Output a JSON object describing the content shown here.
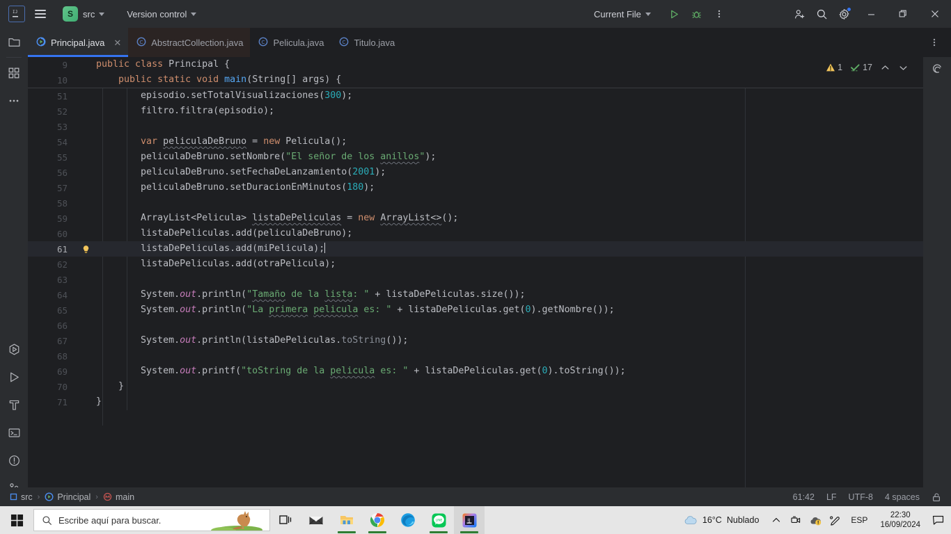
{
  "titlebar": {
    "ij_logo": "intellij-idea-logo",
    "menu_icon": "hamburger-menu-icon",
    "project_badge": "S",
    "project_name": "src",
    "version_control": "Version control",
    "run_config": "Current File",
    "run_icon": "run-icon",
    "debug_icon": "debug-icon",
    "more_icon": "more-vertical-icon",
    "share_icon": "add-user-icon",
    "search_icon": "search-icon",
    "settings_icon": "gear-icon",
    "minimize": "—",
    "maximize": "▢",
    "close": "✕"
  },
  "tabs": [
    {
      "label": "Principal.java",
      "icon": "java-class-run-icon",
      "active": true,
      "closable": true
    },
    {
      "label": "AbstractCollection.java",
      "icon": "java-class-icon",
      "active": false,
      "dim": true
    },
    {
      "label": "Pelicula.java",
      "icon": "java-class-icon",
      "active": false
    },
    {
      "label": "Titulo.java",
      "icon": "java-class-icon",
      "active": false
    }
  ],
  "tabbar_more_icon": "more-vertical-icon",
  "left_rail": {
    "top": [
      {
        "name": "project-icon",
        "title": "Project"
      },
      {
        "name": "commit-icon",
        "title": "Commit"
      },
      {
        "name": "more-tool-windows-icon",
        "title": "More tool windows"
      }
    ],
    "bottom": [
      {
        "name": "run-anything-icon",
        "title": "Run Anything"
      },
      {
        "name": "run-icon",
        "title": "Run"
      },
      {
        "name": "build-icon",
        "title": "Build"
      },
      {
        "name": "terminal-icon",
        "title": "Terminal"
      },
      {
        "name": "problems-icon",
        "title": "Problems"
      },
      {
        "name": "git-icon",
        "title": "Git"
      }
    ]
  },
  "right_rail": {
    "items": [
      {
        "name": "notifications-bell-icon",
        "badge": true
      },
      {
        "name": "ai-assistant-icon",
        "badge": false
      }
    ]
  },
  "inspections": {
    "warning_icon": "warning-triangle-icon",
    "warning_count": "1",
    "ok_icon": "inspections-ok-icon",
    "ok_count": "17",
    "prev_icon": "chevron-up-icon",
    "next_icon": "chevron-down-icon"
  },
  "editor": {
    "sticky_lines": [
      {
        "num": "9",
        "tokens": [
          {
            "t": "    ",
            "c": "plain"
          },
          {
            "t": "public ",
            "c": "kw"
          },
          {
            "t": "class ",
            "c": "kw"
          },
          {
            "t": "Principal {",
            "c": "plain"
          }
        ]
      },
      {
        "num": "10",
        "tokens": [
          {
            "t": "        ",
            "c": "plain"
          },
          {
            "t": "public ",
            "c": "kw"
          },
          {
            "t": "static ",
            "c": "kw"
          },
          {
            "t": "void ",
            "c": "kw"
          },
          {
            "t": "main",
            "c": "fn"
          },
          {
            "t": "(String[] args) {",
            "c": "plain"
          }
        ]
      }
    ],
    "lines": [
      {
        "num": "51",
        "current": false,
        "bulb": false,
        "tokens": [
          {
            "t": "            episodio.setTotalVisualizaciones(",
            "c": "plain"
          },
          {
            "t": "300",
            "c": "num"
          },
          {
            "t": ");",
            "c": "plain"
          }
        ]
      },
      {
        "num": "52",
        "current": false,
        "bulb": false,
        "tokens": [
          {
            "t": "            filtro.filtra(episodio);",
            "c": "plain"
          }
        ]
      },
      {
        "num": "53",
        "current": false,
        "bulb": false,
        "tokens": []
      },
      {
        "num": "54",
        "current": false,
        "bulb": false,
        "tokens": [
          {
            "t": "            ",
            "c": "plain"
          },
          {
            "t": "var ",
            "c": "kw"
          },
          {
            "t": "peliculaDeBruno",
            "c": "wavy"
          },
          {
            "t": " = ",
            "c": "plain"
          },
          {
            "t": "new ",
            "c": "kw"
          },
          {
            "t": "Pelicula();",
            "c": "plain"
          }
        ]
      },
      {
        "num": "55",
        "current": false,
        "bulb": false,
        "tokens": [
          {
            "t": "            peliculaDeBruno.setNombre(",
            "c": "plain"
          },
          {
            "t": "\"El señor de los ",
            "c": "str"
          },
          {
            "t": "anillos",
            "c": "str-wavy"
          },
          {
            "t": "\");",
            "c": "str-end"
          }
        ]
      },
      {
        "num": "56",
        "current": false,
        "bulb": false,
        "tokens": [
          {
            "t": "            peliculaDeBruno.setFechaDeLanzamiento(",
            "c": "plain"
          },
          {
            "t": "2001",
            "c": "num"
          },
          {
            "t": ");",
            "c": "plain"
          }
        ]
      },
      {
        "num": "57",
        "current": false,
        "bulb": false,
        "tokens": [
          {
            "t": "            peliculaDeBruno.setDuracionEnMinutos(",
            "c": "plain"
          },
          {
            "t": "180",
            "c": "num"
          },
          {
            "t": ");",
            "c": "plain"
          }
        ]
      },
      {
        "num": "58",
        "current": false,
        "bulb": false,
        "tokens": []
      },
      {
        "num": "59",
        "current": false,
        "bulb": false,
        "tokens": [
          {
            "t": "            ArrayList<Pelicula> ",
            "c": "plain"
          },
          {
            "t": "listaDePeliculas",
            "c": "wavy"
          },
          {
            "t": " = ",
            "c": "plain"
          },
          {
            "t": "new ",
            "c": "kw"
          },
          {
            "t": "ArrayList<>();",
            "c": "plain"
          }
        ]
      },
      {
        "num": "60",
        "current": false,
        "bulb": false,
        "tokens": [
          {
            "t": "            listaDePeliculas.add(peliculaDeBruno);",
            "c": "plain"
          }
        ]
      },
      {
        "num": "61",
        "current": true,
        "bulb": true,
        "caret": true,
        "tokens": [
          {
            "t": "            listaDePeliculas.add(miPelicula);",
            "c": "plain"
          }
        ]
      },
      {
        "num": "62",
        "current": false,
        "bulb": false,
        "tokens": [
          {
            "t": "            listaDePeliculas.add(otraPelicula);",
            "c": "plain"
          }
        ]
      },
      {
        "num": "63",
        "current": false,
        "bulb": false,
        "tokens": []
      },
      {
        "num": "64",
        "current": false,
        "bulb": false,
        "tokens": [
          {
            "t": "            System.",
            "c": "plain"
          },
          {
            "t": "out",
            "c": "fld"
          },
          {
            "t": ".println(",
            "c": "plain"
          },
          {
            "t": "\"Tamaño",
            "c": "str-wavy2"
          },
          {
            "t": " de la ",
            "c": "str"
          },
          {
            "t": "lista",
            "c": "str-wavy"
          },
          {
            "t": ": \"",
            "c": "str"
          },
          {
            "t": " + listaDePeliculas.size());",
            "c": "plain"
          }
        ]
      },
      {
        "num": "65",
        "current": false,
        "bulb": false,
        "tokens": [
          {
            "t": "            System.",
            "c": "plain"
          },
          {
            "t": "out",
            "c": "fld"
          },
          {
            "t": ".println(",
            "c": "plain"
          },
          {
            "t": "\"La ",
            "c": "str"
          },
          {
            "t": "primera",
            "c": "str-wavy"
          },
          {
            "t": " ",
            "c": "str"
          },
          {
            "t": "pelicula",
            "c": "str-wavy"
          },
          {
            "t": " es: \"",
            "c": "str"
          },
          {
            "t": " + listaDePeliculas.get(",
            "c": "plain"
          },
          {
            "t": "0",
            "c": "num"
          },
          {
            "t": ").getNombre());",
            "c": "plain"
          }
        ]
      },
      {
        "num": "66",
        "current": false,
        "bulb": false,
        "tokens": []
      },
      {
        "num": "67",
        "current": false,
        "bulb": false,
        "tokens": [
          {
            "t": "            System.",
            "c": "plain"
          },
          {
            "t": "out",
            "c": "fld"
          },
          {
            "t": ".println(listaDePeliculas.",
            "c": "plain"
          },
          {
            "t": "toString",
            "c": "stat"
          },
          {
            "t": "());",
            "c": "plain"
          }
        ]
      },
      {
        "num": "68",
        "current": false,
        "bulb": false,
        "tokens": []
      },
      {
        "num": "69",
        "current": false,
        "bulb": false,
        "tokens": [
          {
            "t": "            System.",
            "c": "plain"
          },
          {
            "t": "out",
            "c": "fld"
          },
          {
            "t": ".printf(",
            "c": "plain"
          },
          {
            "t": "\"toString de la ",
            "c": "str"
          },
          {
            "t": "pelicula",
            "c": "str-wavy"
          },
          {
            "t": " es: \"",
            "c": "str"
          },
          {
            "t": " + listaDePeliculas.get(",
            "c": "plain"
          },
          {
            "t": "0",
            "c": "num"
          },
          {
            "t": ").toString());",
            "c": "plain"
          }
        ]
      },
      {
        "num": "70",
        "current": false,
        "bulb": false,
        "tokens": [
          {
            "t": "        }",
            "c": "plain"
          }
        ]
      },
      {
        "num": "71",
        "current": false,
        "bulb": false,
        "tokens": [
          {
            "t": "    }",
            "c": "plain"
          }
        ]
      }
    ]
  },
  "statusbar": {
    "breadcrumb": [
      {
        "label": "src",
        "icon": "module-icon"
      },
      {
        "label": "Principal",
        "icon": "java-class-run-icon"
      },
      {
        "label": "main",
        "icon": "method-icon"
      }
    ],
    "separator": "›",
    "caret_position": "61:42",
    "line_separator": "LF",
    "encoding": "UTF-8",
    "indent": "4 spaces",
    "lock_icon": "unlocked-padlock-icon"
  },
  "taskbar": {
    "start_icon": "windows-start-icon",
    "search": {
      "placeholder": "Escribe aquí para buscar.",
      "value": "",
      "icon": "search-icon",
      "decoration": "kangaroo-illustration"
    },
    "apps": [
      {
        "name": "task-view-icon",
        "label": "Task View",
        "running": false
      },
      {
        "name": "mail-icon",
        "label": "Mail",
        "running": false
      },
      {
        "name": "file-explorer-icon",
        "label": "File Explorer",
        "running": true
      },
      {
        "name": "chrome-icon",
        "label": "Google Chrome",
        "running": true
      },
      {
        "name": "edge-icon",
        "label": "Microsoft Edge",
        "running": false
      },
      {
        "name": "line-icon",
        "label": "LINE",
        "running": true
      },
      {
        "name": "intellij-idea-icon",
        "label": "IntelliJ IDEA",
        "running": true,
        "active": true
      }
    ],
    "weather": {
      "icon": "cloud-icon",
      "temperature": "16°C",
      "condition": "Nublado"
    },
    "tray": {
      "expand_icon": "chevron-up-icon",
      "icons": [
        {
          "name": "camera-privacy-icon"
        },
        {
          "name": "onedrive-warning-icon"
        },
        {
          "name": "pen-settings-icon"
        }
      ],
      "language": "ESP",
      "time": "22:30",
      "date": "16/09/2024",
      "action_center_icon": "action-center-icon"
    }
  },
  "colors": {
    "accent_blue": "#3574f0",
    "editor_bg": "#1e1f22",
    "panel_bg": "#2b2d30",
    "keyword": "#cf8e6d",
    "string": "#6aab73",
    "number": "#2aacb8",
    "method": "#56a8f5",
    "field": "#c77dbb",
    "taskbar_bg": "#e6e6e6"
  }
}
